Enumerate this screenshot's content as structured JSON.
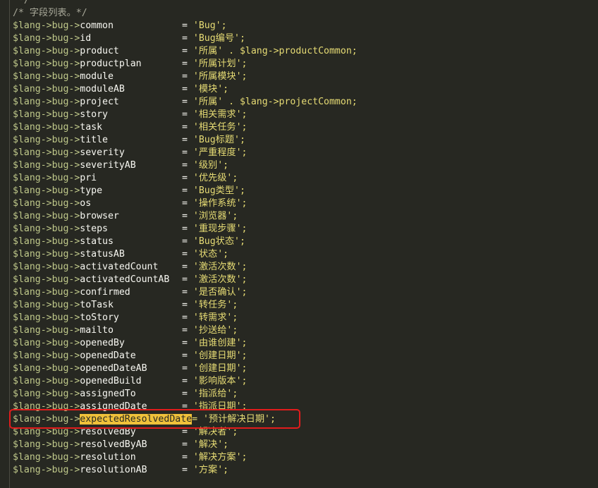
{
  "top_comment_tail": " */",
  "section_comment": "/* 字段列表。*/",
  "prefix": "$lang->bug->",
  "lines": [
    {
      "field": "common",
      "value": "'Bug';"
    },
    {
      "field": "id",
      "value": "'Bug编号';"
    },
    {
      "field": "product",
      "value": "'所属' . $lang->productCommon;"
    },
    {
      "field": "productplan",
      "value": "'所属计划';"
    },
    {
      "field": "module",
      "value": "'所属模块';"
    },
    {
      "field": "moduleAB",
      "value": "'模块';"
    },
    {
      "field": "project",
      "value": "'所属' . $lang->projectCommon;"
    },
    {
      "field": "story",
      "value": "'相关需求';"
    },
    {
      "field": "task",
      "value": "'相关任务';"
    },
    {
      "field": "title",
      "value": "'Bug标题';"
    },
    {
      "field": "severity",
      "value": "'严重程度';"
    },
    {
      "field": "severityAB",
      "value": "'级别';"
    },
    {
      "field": "pri",
      "value": "'优先级';"
    },
    {
      "field": "type",
      "value": "'Bug类型';"
    },
    {
      "field": "os",
      "value": "'操作系统';"
    },
    {
      "field": "browser",
      "value": "'浏览器';"
    },
    {
      "field": "steps",
      "value": "'重现步骤';"
    },
    {
      "field": "status",
      "value": "'Bug状态';"
    },
    {
      "field": "statusAB",
      "value": "'状态';"
    },
    {
      "field": "activatedCount",
      "value": "'激活次数';"
    },
    {
      "field": "activatedCountAB",
      "value": "'激活次数';"
    },
    {
      "field": "confirmed",
      "value": "'是否确认';"
    },
    {
      "field": "toTask",
      "value": "'转任务';"
    },
    {
      "field": "toStory",
      "value": "'转需求';"
    },
    {
      "field": "mailto",
      "value": "'抄送给';"
    },
    {
      "field": "openedBy",
      "value": "'由谁创建';"
    },
    {
      "field": "openedDate",
      "value": "'创建日期';"
    },
    {
      "field": "openedDateAB",
      "value": "'创建日期';"
    },
    {
      "field": "openedBuild",
      "value": "'影响版本';"
    },
    {
      "field": "assignedTo",
      "value": "'指派给';"
    },
    {
      "field": "assignedDate",
      "value": "'指派日期';"
    },
    {
      "field": "expectedResolvedDate",
      "value": "= '预计解决日期';",
      "highlighted": true
    },
    {
      "field": "resolvedBy",
      "value": "'解决者';"
    },
    {
      "field": "resolvedByAB",
      "value": "'解决';"
    },
    {
      "field": "resolution",
      "value": "'解决方案';"
    },
    {
      "field": "resolutionAB",
      "value": "'方案';"
    }
  ],
  "colors": {
    "background": "#272822",
    "string": "#e6db74",
    "highlight": "#f0c13a",
    "annotation_box": "#e21c1c"
  }
}
